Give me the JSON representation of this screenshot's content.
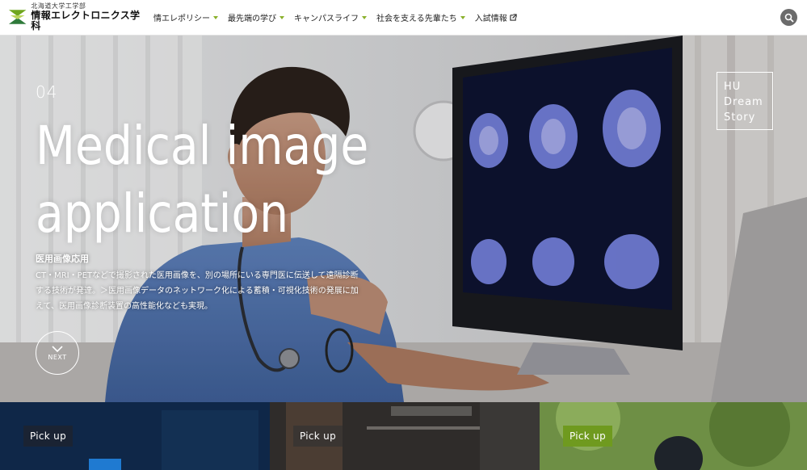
{
  "header": {
    "logo_sub": "北海道大学工学部",
    "logo_main": "情報エレクトロニクス学科",
    "nav": [
      {
        "label": "情エレポリシー"
      },
      {
        "label": "最先端の学び"
      },
      {
        "label": "キャンパスライフ"
      },
      {
        "label": "社会を支える先輩たち"
      },
      {
        "label": "入試情報"
      }
    ]
  },
  "hero": {
    "number": "04",
    "title_line1": "Medical image",
    "title_line2": "application",
    "subtitle": "医用画像応用",
    "description": "CT・MRI・PETなどで撮影された医用画像を、別の場所にいる専門医に伝送して遠隔診断する技術が発達。＞医用画像データのネットワーク化による蓄積・可視化技術の発展に加えて、医用画像診断装置の高性能化なども実現。",
    "next_label": "NEXT",
    "dream_line1": "HU",
    "dream_line2": "Dream",
    "dream_line3": "Story"
  },
  "pickups": [
    {
      "label": "Pick up",
      "tag_color": "#1a2333"
    },
    {
      "label": "Pick up",
      "tag_color": "#3a3532"
    },
    {
      "label": "Pick up",
      "tag_color": "#6f9a1f"
    }
  ],
  "colors": {
    "accent": "#8ab02b",
    "logo_green": "#6fa51e",
    "search_bg": "#6b6b6b"
  }
}
